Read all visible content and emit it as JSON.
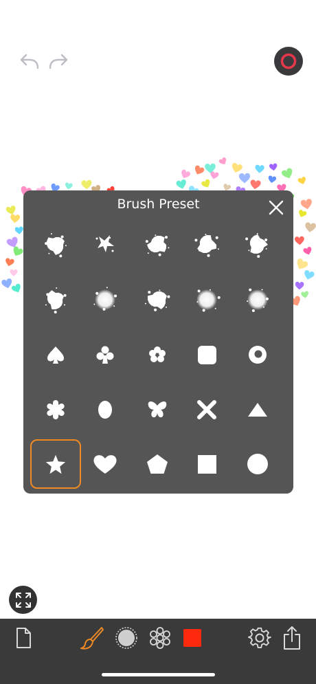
{
  "canvas": {
    "heart_colors": [
      "#ff4fa3",
      "#ffd23f",
      "#4fd1ff",
      "#9b5cff",
      "#54e346",
      "#ff6b3d",
      "#ff9ad5",
      "#5b8cff",
      "#2ee6c5",
      "#e6e628",
      "#c9a06b",
      "#ff3b30"
    ]
  },
  "top_bar": {
    "undo_icon": "undo-arrow-icon",
    "redo_icon": "redo-arrow-icon",
    "record_icon": "record-circle-icon",
    "record_color": "#e5384b"
  },
  "brush_preset": {
    "title": "Brush Preset",
    "close_icon": "close-x-icon",
    "selected_index": 20,
    "accent_color": "#f08a24",
    "presets": [
      "splatter-brush-1",
      "splatter-brush-2",
      "splatter-brush-3",
      "splatter-brush-4",
      "splatter-brush-5",
      "splatter-brush-6",
      "soft-round-brush-1",
      "soft-round-brush-2",
      "soft-round-brush-3",
      "soft-round-brush-4",
      "spade-brush",
      "club-brush",
      "flower-brush",
      "rounded-square-brush",
      "ring-brush",
      "asterisk-brush",
      "oval-brush",
      "butterfly-brush",
      "x-cross-brush",
      "triangle-brush",
      "star-brush",
      "heart-brush",
      "pentagon-brush",
      "square-brush",
      "circle-brush"
    ]
  },
  "toolbar": {
    "new_document_icon": "document-icon",
    "brush_icon": "paintbrush-icon",
    "brush_icon_color": "#f08a24",
    "brush_size_icon": "brush-size-circle-icon",
    "pattern_icon": "pattern-flower-icon",
    "current_color": "#ff2a0d",
    "settings_icon": "gear-icon",
    "share_icon": "share-icon"
  },
  "expand_icon": "expand-arrows-icon"
}
